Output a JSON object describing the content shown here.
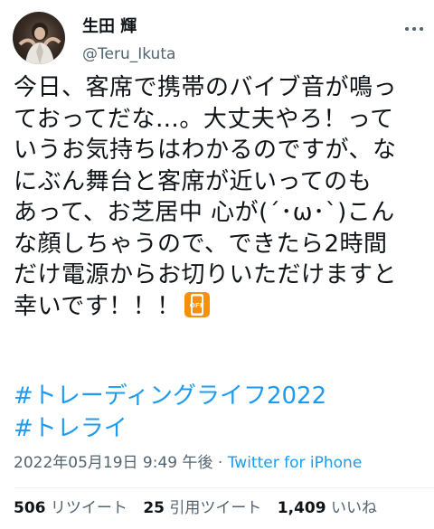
{
  "tweet": {
    "author": {
      "name": "生田 輝",
      "handle": "@Teru_Ikuta"
    },
    "body_lines": [
      "今日、客席で携帯のバイブ音が鳴っ",
      "ておってだな…。大丈夫やろ！って",
      "いうお気持ちはわかるのですが、な",
      "にぶん舞台と客席が近いってのも",
      "あって、お芝居中 心が(´･ω･`)こん",
      "な顔しちゃうので、できたら2時間",
      "だけ電源からお切りいただけますと",
      "幸いです！！！"
    ],
    "emoji": {
      "icon": "mobile-phone-off-icon",
      "label": "OFF",
      "color": "#f4900c"
    },
    "hashtags": [
      "#トレーディングライフ2022",
      "#トレライ"
    ],
    "timestamp": "2022年05月19日 9:49 午後",
    "separator": "·",
    "source": "Twitter for iPhone",
    "stats": {
      "retweets": {
        "count": "506",
        "label": "リツイート"
      },
      "quotes": {
        "count": "25",
        "label": "引用ツイート"
      },
      "likes": {
        "count": "1,409",
        "label": "いいね"
      }
    }
  },
  "colors": {
    "text": "#0f1419",
    "secondary": "#536471",
    "link": "#1d9bf0",
    "divider": "#eff3f4"
  }
}
